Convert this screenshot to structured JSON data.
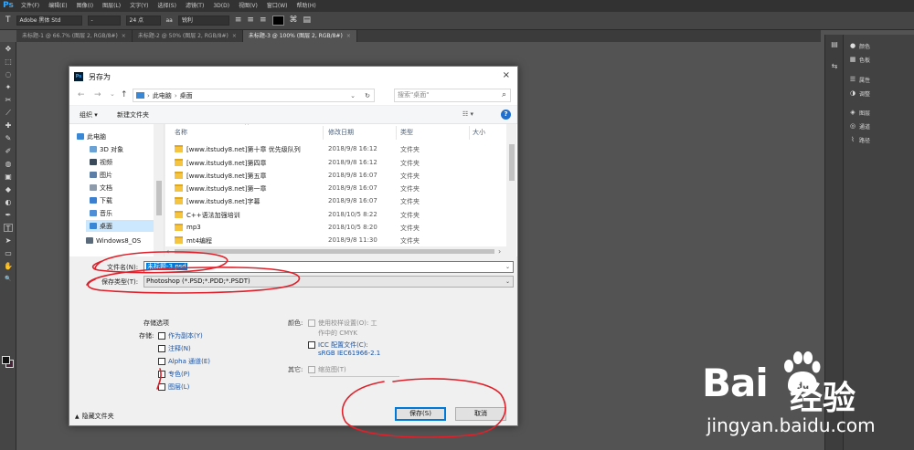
{
  "app": {
    "logo": "Ps"
  },
  "menu": [
    "文件(F)",
    "编辑(E)",
    "图像(I)",
    "图层(L)",
    "文字(Y)",
    "选择(S)",
    "滤镜(T)",
    "3D(D)",
    "视图(V)",
    "窗口(W)",
    "帮助(H)"
  ],
  "options": {
    "tool_glyph": "T",
    "font_family": "Adobe 黑体 Std",
    "font_style": "-",
    "font_size": "24 点",
    "aa": "aa",
    "aa_mode": "锐利"
  },
  "tabs": [
    {
      "label": "未标题-1 @ 66.7% (图层 2, RGB/8#)",
      "close": "×"
    },
    {
      "label": "未标题-2 @ 50% (图层 2, RGB/8#)",
      "close": "×"
    },
    {
      "label": "未标题-3 @ 100% (图层 2, RGB/8#)",
      "close": "×"
    }
  ],
  "tools": [
    "✥",
    "⬚",
    "◌",
    "✦",
    "✂",
    "⟋",
    "✚",
    "✎",
    "✐",
    "◍",
    "▣",
    "◆",
    "◐",
    "✒",
    "T",
    "➤",
    "▭",
    "✋",
    "🔍"
  ],
  "panels": {
    "items": [
      {
        "icon": "●",
        "label": "颜色"
      },
      {
        "icon": "▦",
        "label": "色板"
      },
      {
        "icon": "☰",
        "label": "属性"
      },
      {
        "icon": "◑",
        "label": "调整"
      },
      {
        "icon": "◈",
        "label": "图层"
      },
      {
        "icon": "◎",
        "label": "通道"
      },
      {
        "icon": "⌇",
        "label": "路径"
      }
    ],
    "dock_icons": [
      "▤",
      "⇆"
    ]
  },
  "dialog": {
    "title": "另存为",
    "close": "×",
    "nav": {
      "back": "←",
      "forward": "→",
      "dropdown": "⌄",
      "up": "↑"
    },
    "address": {
      "sep1": "›",
      "root": "此电脑",
      "sep2": "›",
      "folder": "桌面",
      "dropdown": "⌄",
      "refresh": "↻"
    },
    "search": {
      "placeholder": "搜索\"桌面\"",
      "icon": "⌕"
    },
    "commands": {
      "organize": "组织 ▾",
      "new_folder": "新建文件夹",
      "view": "☷ ▾",
      "help": "?"
    },
    "sidebar": [
      {
        "label": "此电脑",
        "color": "#3a87d6"
      },
      {
        "label": "3D 对象",
        "color": "#6aa2d6"
      },
      {
        "label": "视频",
        "color": "#3b4a5a"
      },
      {
        "label": "图片",
        "color": "#5b7fa6"
      },
      {
        "label": "文档",
        "color": "#8d9bab"
      },
      {
        "label": "下载",
        "color": "#3a7fd0"
      },
      {
        "label": "音乐",
        "color": "#4e8fd6"
      },
      {
        "label": "桌面",
        "color": "#3a87d6"
      },
      {
        "label": "Windows8_OS",
        "color": "#5a6a7a"
      }
    ],
    "columns": {
      "name": "名称",
      "sort": "^",
      "date": "修改日期",
      "type": "类型",
      "size": "大小"
    },
    "files": [
      {
        "name": "[www.itstudy8.net]第十章 优先级队列",
        "date": "2018/9/8 16:12",
        "type": "文件夹"
      },
      {
        "name": "[www.itstudy8.net]第四章",
        "date": "2018/9/8 16:12",
        "type": "文件夹"
      },
      {
        "name": "[www.itstudy8.net]第五章",
        "date": "2018/9/8 16:07",
        "type": "文件夹"
      },
      {
        "name": "[www.itstudy8.net]第一章",
        "date": "2018/9/8 16:07",
        "type": "文件夹"
      },
      {
        "name": "[www.itstudy8.net]字幕",
        "date": "2018/9/8 16:07",
        "type": "文件夹"
      },
      {
        "name": "C++语法加强培训",
        "date": "2018/10/5 8:22",
        "type": "文件夹"
      },
      {
        "name": "mp3",
        "date": "2018/10/5 8:20",
        "type": "文件夹"
      },
      {
        "name": "mt4编程",
        "date": "2018/9/8 11:30",
        "type": "文件夹"
      }
    ],
    "scroll": {
      "left": "‹",
      "right": "›",
      "dropdown": "⌄"
    },
    "filename": {
      "label": "文件名(N):",
      "value": "未标题-3.psd"
    },
    "filetype": {
      "label": "保存类型(T):",
      "value": "Photoshop (*.PSD;*.PDD;*.PSDT)"
    },
    "save_options": {
      "title": "存储选项",
      "save_label": "存储:",
      "items": [
        {
          "label": "作为副本(Y)",
          "checked": false
        },
        {
          "label": "注释(N)",
          "checked": false
        },
        {
          "label": "Alpha 通道(E)",
          "checked": false
        },
        {
          "label": "专色(P)",
          "checked": false
        },
        {
          "label": "图层(L)",
          "checked": false
        }
      ]
    },
    "color_options": {
      "label": "颜色:",
      "proof": "使用校样设置(O):  工",
      "proof2": "作中的 CMYK",
      "icc": "ICC 配置文件(C):",
      "icc_profile": "sRGB IEC61966-2.1"
    },
    "other": {
      "label": "其它:",
      "thumbnail": "缩览图(T)"
    },
    "hide_folders": "隐藏文件夹",
    "save_button": "保存(S)",
    "cancel_button": "取消"
  },
  "watermark": {
    "logo": "Bai",
    "paw": "du",
    "jingyan": "经验",
    "url": "jingyan.baidu.com"
  },
  "colors": {
    "ps_bg": "#535353",
    "accent": "#0078d7",
    "annotation": "#e0202a"
  }
}
